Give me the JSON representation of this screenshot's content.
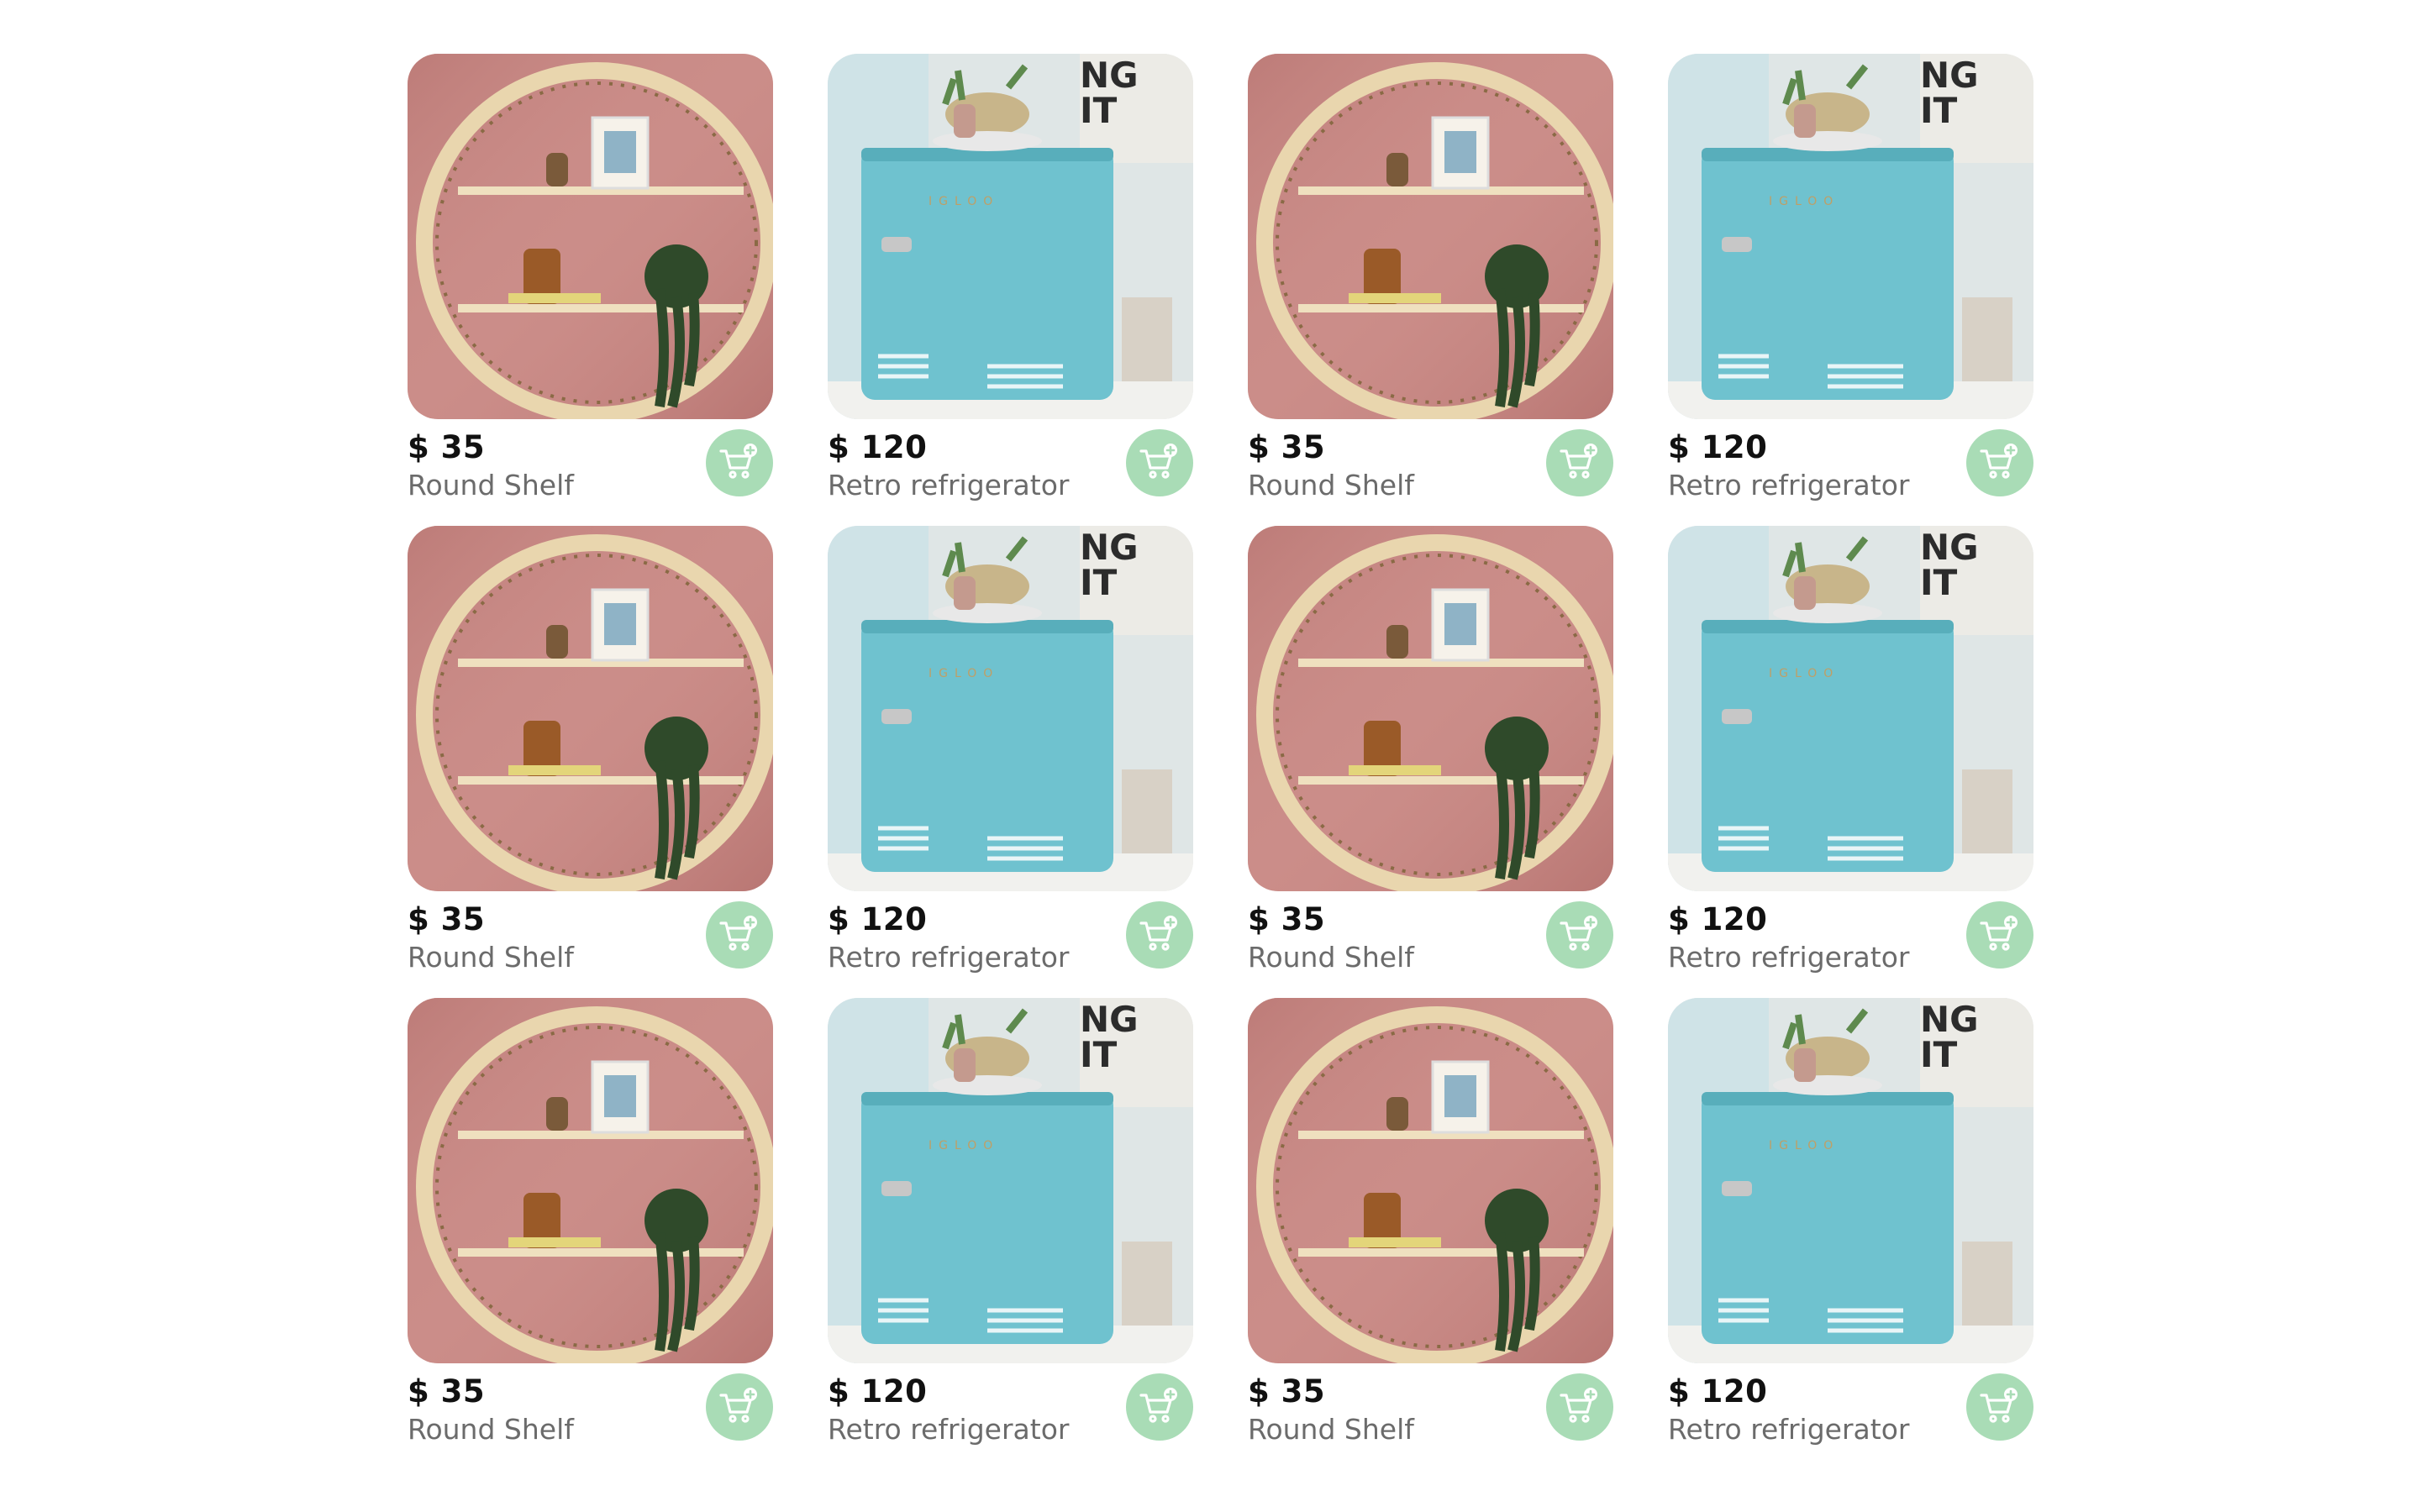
{
  "products": [
    {
      "price": "$ 35",
      "name": "Round Shelf",
      "image": "round-shelf"
    },
    {
      "price": "$ 120",
      "name": "Retro refrigerator",
      "image": "retro-fridge"
    },
    {
      "price": "$ 35",
      "name": "Round Shelf",
      "image": "round-shelf"
    },
    {
      "price": "$ 120",
      "name": "Retro refrigerator",
      "image": "retro-fridge"
    },
    {
      "price": "$ 35",
      "name": "Round Shelf",
      "image": "round-shelf"
    },
    {
      "price": "$ 120",
      "name": "Retro refrigerator",
      "image": "retro-fridge"
    },
    {
      "price": "$ 35",
      "name": "Round Shelf",
      "image": "round-shelf"
    },
    {
      "price": "$ 120",
      "name": "Retro refrigerator",
      "image": "retro-fridge"
    },
    {
      "price": "$ 35",
      "name": "Round Shelf",
      "image": "round-shelf"
    },
    {
      "price": "$ 120",
      "name": "Retro refrigerator",
      "image": "retro-fridge"
    },
    {
      "price": "$ 35",
      "name": "Round Shelf",
      "image": "round-shelf"
    },
    {
      "price": "$ 120",
      "name": "Retro refrigerator",
      "image": "retro-fridge"
    }
  ],
  "icons": {
    "cart": "add-to-cart-icon"
  },
  "colors": {
    "cart_button": "#a9dcb6",
    "cart_icon": "#ffffff",
    "price": "#111111",
    "name": "#6b6b6b"
  }
}
